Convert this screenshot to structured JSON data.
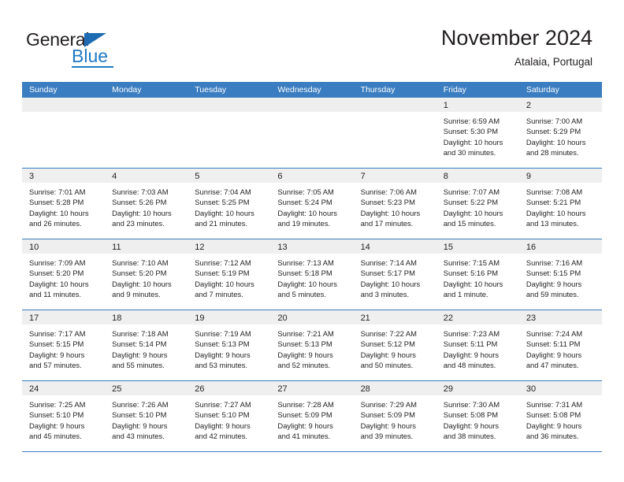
{
  "brand": {
    "name_part1": "General",
    "name_part2": "Blue"
  },
  "header": {
    "title": "November 2024",
    "subtitle": "Atalaia, Portugal"
  },
  "colors": {
    "header_blue": "#3a7dc0",
    "logo_blue": "#2079c4",
    "daynum_strip": "#efefef",
    "text": "#231f20"
  },
  "weekday_headers": [
    "Sunday",
    "Monday",
    "Tuesday",
    "Wednesday",
    "Thursday",
    "Friday",
    "Saturday"
  ],
  "weeks": [
    [
      {
        "day": "",
        "empty": true,
        "sunrise": "",
        "sunset": "",
        "daylight_line1": "",
        "daylight_line2": ""
      },
      {
        "day": "",
        "empty": true,
        "sunrise": "",
        "sunset": "",
        "daylight_line1": "",
        "daylight_line2": ""
      },
      {
        "day": "",
        "empty": true,
        "sunrise": "",
        "sunset": "",
        "daylight_line1": "",
        "daylight_line2": ""
      },
      {
        "day": "",
        "empty": true,
        "sunrise": "",
        "sunset": "",
        "daylight_line1": "",
        "daylight_line2": ""
      },
      {
        "day": "",
        "empty": true,
        "sunrise": "",
        "sunset": "",
        "daylight_line1": "",
        "daylight_line2": ""
      },
      {
        "day": "1",
        "empty": false,
        "sunrise": "Sunrise: 6:59 AM",
        "sunset": "Sunset: 5:30 PM",
        "daylight_line1": "Daylight: 10 hours",
        "daylight_line2": "and 30 minutes."
      },
      {
        "day": "2",
        "empty": false,
        "sunrise": "Sunrise: 7:00 AM",
        "sunset": "Sunset: 5:29 PM",
        "daylight_line1": "Daylight: 10 hours",
        "daylight_line2": "and 28 minutes."
      }
    ],
    [
      {
        "day": "3",
        "empty": false,
        "sunrise": "Sunrise: 7:01 AM",
        "sunset": "Sunset: 5:28 PM",
        "daylight_line1": "Daylight: 10 hours",
        "daylight_line2": "and 26 minutes."
      },
      {
        "day": "4",
        "empty": false,
        "sunrise": "Sunrise: 7:03 AM",
        "sunset": "Sunset: 5:26 PM",
        "daylight_line1": "Daylight: 10 hours",
        "daylight_line2": "and 23 minutes."
      },
      {
        "day": "5",
        "empty": false,
        "sunrise": "Sunrise: 7:04 AM",
        "sunset": "Sunset: 5:25 PM",
        "daylight_line1": "Daylight: 10 hours",
        "daylight_line2": "and 21 minutes."
      },
      {
        "day": "6",
        "empty": false,
        "sunrise": "Sunrise: 7:05 AM",
        "sunset": "Sunset: 5:24 PM",
        "daylight_line1": "Daylight: 10 hours",
        "daylight_line2": "and 19 minutes."
      },
      {
        "day": "7",
        "empty": false,
        "sunrise": "Sunrise: 7:06 AM",
        "sunset": "Sunset: 5:23 PM",
        "daylight_line1": "Daylight: 10 hours",
        "daylight_line2": "and 17 minutes."
      },
      {
        "day": "8",
        "empty": false,
        "sunrise": "Sunrise: 7:07 AM",
        "sunset": "Sunset: 5:22 PM",
        "daylight_line1": "Daylight: 10 hours",
        "daylight_line2": "and 15 minutes."
      },
      {
        "day": "9",
        "empty": false,
        "sunrise": "Sunrise: 7:08 AM",
        "sunset": "Sunset: 5:21 PM",
        "daylight_line1": "Daylight: 10 hours",
        "daylight_line2": "and 13 minutes."
      }
    ],
    [
      {
        "day": "10",
        "empty": false,
        "sunrise": "Sunrise: 7:09 AM",
        "sunset": "Sunset: 5:20 PM",
        "daylight_line1": "Daylight: 10 hours",
        "daylight_line2": "and 11 minutes."
      },
      {
        "day": "11",
        "empty": false,
        "sunrise": "Sunrise: 7:10 AM",
        "sunset": "Sunset: 5:20 PM",
        "daylight_line1": "Daylight: 10 hours",
        "daylight_line2": "and 9 minutes."
      },
      {
        "day": "12",
        "empty": false,
        "sunrise": "Sunrise: 7:12 AM",
        "sunset": "Sunset: 5:19 PM",
        "daylight_line1": "Daylight: 10 hours",
        "daylight_line2": "and 7 minutes."
      },
      {
        "day": "13",
        "empty": false,
        "sunrise": "Sunrise: 7:13 AM",
        "sunset": "Sunset: 5:18 PM",
        "daylight_line1": "Daylight: 10 hours",
        "daylight_line2": "and 5 minutes."
      },
      {
        "day": "14",
        "empty": false,
        "sunrise": "Sunrise: 7:14 AM",
        "sunset": "Sunset: 5:17 PM",
        "daylight_line1": "Daylight: 10 hours",
        "daylight_line2": "and 3 minutes."
      },
      {
        "day": "15",
        "empty": false,
        "sunrise": "Sunrise: 7:15 AM",
        "sunset": "Sunset: 5:16 PM",
        "daylight_line1": "Daylight: 10 hours",
        "daylight_line2": "and 1 minute."
      },
      {
        "day": "16",
        "empty": false,
        "sunrise": "Sunrise: 7:16 AM",
        "sunset": "Sunset: 5:15 PM",
        "daylight_line1": "Daylight: 9 hours",
        "daylight_line2": "and 59 minutes."
      }
    ],
    [
      {
        "day": "17",
        "empty": false,
        "sunrise": "Sunrise: 7:17 AM",
        "sunset": "Sunset: 5:15 PM",
        "daylight_line1": "Daylight: 9 hours",
        "daylight_line2": "and 57 minutes."
      },
      {
        "day": "18",
        "empty": false,
        "sunrise": "Sunrise: 7:18 AM",
        "sunset": "Sunset: 5:14 PM",
        "daylight_line1": "Daylight: 9 hours",
        "daylight_line2": "and 55 minutes."
      },
      {
        "day": "19",
        "empty": false,
        "sunrise": "Sunrise: 7:19 AM",
        "sunset": "Sunset: 5:13 PM",
        "daylight_line1": "Daylight: 9 hours",
        "daylight_line2": "and 53 minutes."
      },
      {
        "day": "20",
        "empty": false,
        "sunrise": "Sunrise: 7:21 AM",
        "sunset": "Sunset: 5:13 PM",
        "daylight_line1": "Daylight: 9 hours",
        "daylight_line2": "and 52 minutes."
      },
      {
        "day": "21",
        "empty": false,
        "sunrise": "Sunrise: 7:22 AM",
        "sunset": "Sunset: 5:12 PM",
        "daylight_line1": "Daylight: 9 hours",
        "daylight_line2": "and 50 minutes."
      },
      {
        "day": "22",
        "empty": false,
        "sunrise": "Sunrise: 7:23 AM",
        "sunset": "Sunset: 5:11 PM",
        "daylight_line1": "Daylight: 9 hours",
        "daylight_line2": "and 48 minutes."
      },
      {
        "day": "23",
        "empty": false,
        "sunrise": "Sunrise: 7:24 AM",
        "sunset": "Sunset: 5:11 PM",
        "daylight_line1": "Daylight: 9 hours",
        "daylight_line2": "and 47 minutes."
      }
    ],
    [
      {
        "day": "24",
        "empty": false,
        "sunrise": "Sunrise: 7:25 AM",
        "sunset": "Sunset: 5:10 PM",
        "daylight_line1": "Daylight: 9 hours",
        "daylight_line2": "and 45 minutes."
      },
      {
        "day": "25",
        "empty": false,
        "sunrise": "Sunrise: 7:26 AM",
        "sunset": "Sunset: 5:10 PM",
        "daylight_line1": "Daylight: 9 hours",
        "daylight_line2": "and 43 minutes."
      },
      {
        "day": "26",
        "empty": false,
        "sunrise": "Sunrise: 7:27 AM",
        "sunset": "Sunset: 5:10 PM",
        "daylight_line1": "Daylight: 9 hours",
        "daylight_line2": "and 42 minutes."
      },
      {
        "day": "27",
        "empty": false,
        "sunrise": "Sunrise: 7:28 AM",
        "sunset": "Sunset: 5:09 PM",
        "daylight_line1": "Daylight: 9 hours",
        "daylight_line2": "and 41 minutes."
      },
      {
        "day": "28",
        "empty": false,
        "sunrise": "Sunrise: 7:29 AM",
        "sunset": "Sunset: 5:09 PM",
        "daylight_line1": "Daylight: 9 hours",
        "daylight_line2": "and 39 minutes."
      },
      {
        "day": "29",
        "empty": false,
        "sunrise": "Sunrise: 7:30 AM",
        "sunset": "Sunset: 5:08 PM",
        "daylight_line1": "Daylight: 9 hours",
        "daylight_line2": "and 38 minutes."
      },
      {
        "day": "30",
        "empty": false,
        "sunrise": "Sunrise: 7:31 AM",
        "sunset": "Sunset: 5:08 PM",
        "daylight_line1": "Daylight: 9 hours",
        "daylight_line2": "and 36 minutes."
      }
    ]
  ]
}
